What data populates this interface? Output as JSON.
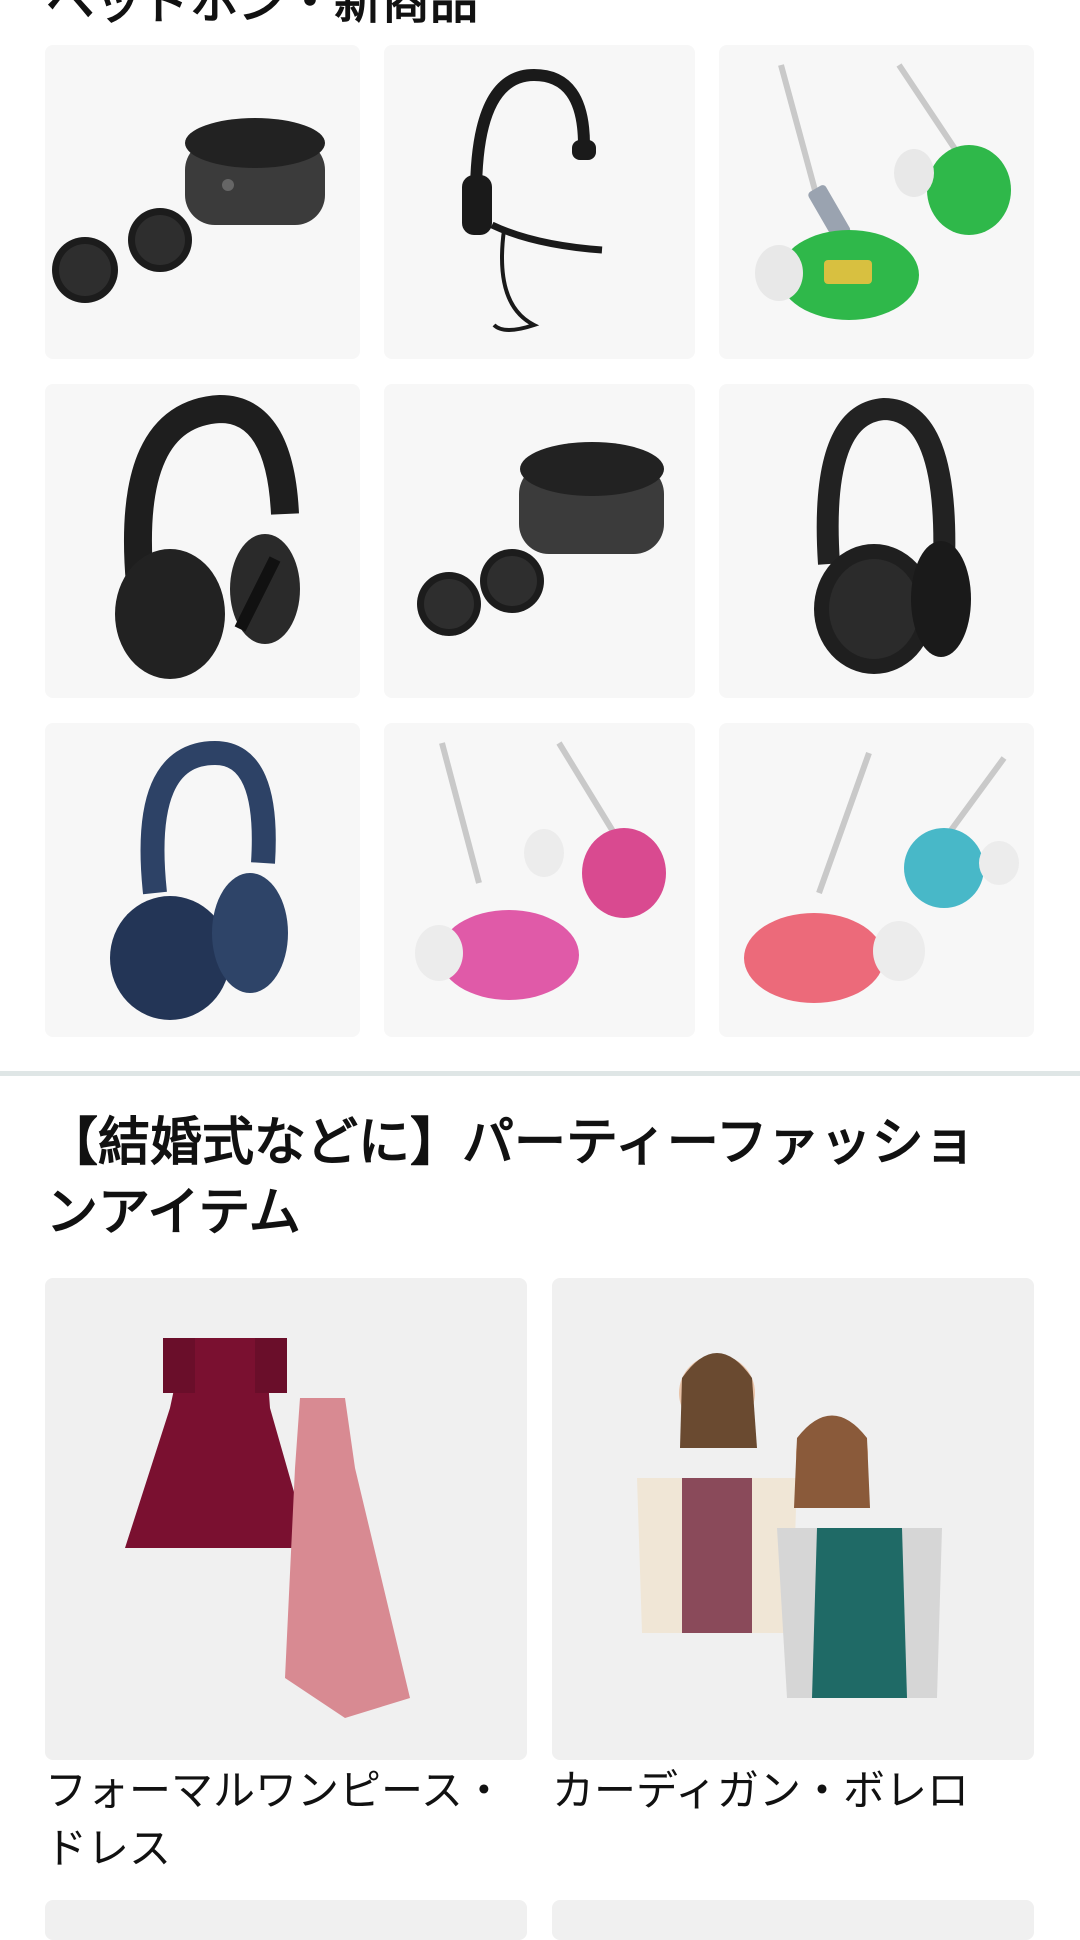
{
  "section1": {
    "title": "ヘッドホン・新商品",
    "tiles": [
      {
        "icon": "earbuds-case-icon"
      },
      {
        "icon": "headset-icon"
      },
      {
        "icon": "in-ear-monitor-green-icon"
      },
      {
        "icon": "headphones-black-icon"
      },
      {
        "icon": "earbuds-case-icon"
      },
      {
        "icon": "headphones-black-icon"
      },
      {
        "icon": "headphones-navy-icon"
      },
      {
        "icon": "in-ear-monitor-pink-icon"
      },
      {
        "icon": "in-ear-monitor-pink-blue-icon"
      }
    ]
  },
  "section2": {
    "title": "【結婚式などに】パーティーファッションアイテム",
    "cards": [
      {
        "label": "フォーマルワンピース・ドレス",
        "icon": "dresses-icon"
      },
      {
        "label": "カーディガン・ボレロ",
        "icon": "models-cardigan-icon"
      }
    ]
  },
  "colors": {
    "tile_bg": "#f7f7f7",
    "card_bg": "#f0f0f0",
    "divider": "#dfe6e6"
  }
}
